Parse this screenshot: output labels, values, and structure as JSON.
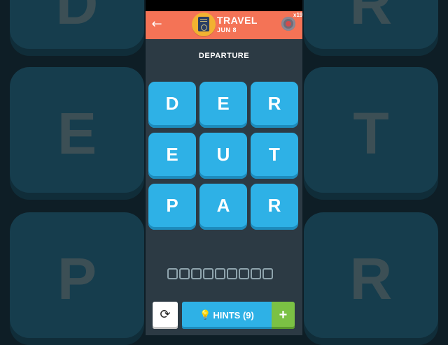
{
  "background_letters": [
    "D",
    "R",
    "E",
    "T",
    "P",
    "R"
  ],
  "header": {
    "back_icon": "←",
    "badge_icon": "passport-icon",
    "title": "TRAVEL",
    "date": "JUN 8",
    "coin_icon": "coin-icon",
    "coin_count": "x19"
  },
  "puzzle": {
    "word": "DEPARTURE",
    "tiles": [
      "D",
      "E",
      "R",
      "E",
      "U",
      "T",
      "P",
      "A",
      "R"
    ],
    "answer_slots": 9
  },
  "footer": {
    "refresh_icon": "⟳",
    "hints_label": "HINTS (9)",
    "bulb_icon": "💡",
    "plus_label": "+"
  },
  "colors": {
    "header": "#f47356",
    "tile": "#2eb1e6",
    "screen_bg": "#2c3a44",
    "plus_button": "#7bc144",
    "badge": "#f2b231"
  }
}
